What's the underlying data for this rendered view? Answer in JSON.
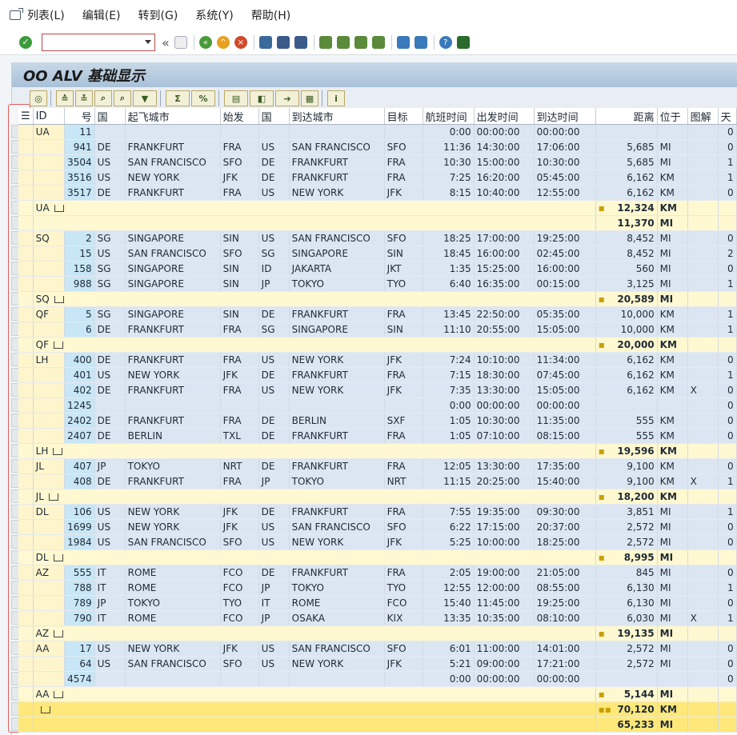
{
  "menu": {
    "items": [
      "列表(L)",
      "编辑(E)",
      "转到(G)",
      "系统(Y)",
      "帮助(H)"
    ]
  },
  "toolbar": {
    "command_placeholder": "",
    "double_arrow": "«"
  },
  "title": "OO ALV 基础显示",
  "columns": [
    "ID",
    "号",
    "国",
    "起飞城市",
    "始发",
    "国",
    "到达城市",
    "目标",
    "航班时间",
    "出发时间",
    "到达时间",
    "距离",
    "位于",
    "图解",
    "天"
  ],
  "colors": {
    "title_bar": "#b4c9dd",
    "subtotal": "#fff8d0",
    "total": "#ffe87a",
    "selection_border": "#e05a5a"
  },
  "rows": [
    {
      "kind": "data",
      "cells": [
        "UA",
        "11",
        "",
        "",
        "",
        "",
        "",
        "",
        "0:00",
        "00:00:00",
        "00:00:00",
        "",
        "",
        "",
        "0"
      ]
    },
    {
      "kind": "data",
      "cells": [
        "",
        "941",
        "DE",
        "FRANKFURT",
        "FRA",
        "US",
        "SAN FRANCISCO",
        "SFO",
        "11:36",
        "14:30:00",
        "17:06:00",
        "5,685",
        "MI",
        "",
        "0"
      ]
    },
    {
      "kind": "data",
      "cells": [
        "",
        "3504",
        "US",
        "SAN FRANCISCO",
        "SFO",
        "DE",
        "FRANKFURT",
        "FRA",
        "10:30",
        "15:00:00",
        "10:30:00",
        "5,685",
        "MI",
        "",
        "1"
      ]
    },
    {
      "kind": "data",
      "cells": [
        "",
        "3516",
        "US",
        "NEW YORK",
        "JFK",
        "DE",
        "FRANKFURT",
        "FRA",
        "7:25",
        "16:20:00",
        "05:45:00",
        "6,162",
        "KM",
        "",
        "1"
      ]
    },
    {
      "kind": "data",
      "cells": [
        "",
        "3517",
        "DE",
        "FRANKFURT",
        "FRA",
        "US",
        "NEW YORK",
        "JFK",
        "8:15",
        "10:40:00",
        "12:55:00",
        "6,162",
        "KM",
        "",
        "0"
      ]
    },
    {
      "kind": "sub",
      "label": "UA",
      "dist": "12,324",
      "unit": "KM"
    },
    {
      "kind": "sub2",
      "label": "",
      "dist": "11,370",
      "unit": "MI"
    },
    {
      "kind": "data",
      "cells": [
        "SQ",
        "2",
        "SG",
        "SINGAPORE",
        "SIN",
        "US",
        "SAN FRANCISCO",
        "SFO",
        "18:25",
        "17:00:00",
        "19:25:00",
        "8,452",
        "MI",
        "",
        "0"
      ]
    },
    {
      "kind": "data",
      "cells": [
        "",
        "15",
        "US",
        "SAN FRANCISCO",
        "SFO",
        "SG",
        "SINGAPORE",
        "SIN",
        "18:45",
        "16:00:00",
        "02:45:00",
        "8,452",
        "MI",
        "",
        "2"
      ]
    },
    {
      "kind": "data",
      "cells": [
        "",
        "158",
        "SG",
        "SINGAPORE",
        "SIN",
        "ID",
        "JAKARTA",
        "JKT",
        "1:35",
        "15:25:00",
        "16:00:00",
        "560",
        "MI",
        "",
        "0"
      ]
    },
    {
      "kind": "data",
      "cells": [
        "",
        "988",
        "SG",
        "SINGAPORE",
        "SIN",
        "JP",
        "TOKYO",
        "TYO",
        "6:40",
        "16:35:00",
        "00:15:00",
        "3,125",
        "MI",
        "",
        "1"
      ]
    },
    {
      "kind": "sub",
      "label": "SQ",
      "dist": "20,589",
      "unit": "MI"
    },
    {
      "kind": "data",
      "cells": [
        "QF",
        "5",
        "SG",
        "SINGAPORE",
        "SIN",
        "DE",
        "FRANKFURT",
        "FRA",
        "13:45",
        "22:50:00",
        "05:35:00",
        "10,000",
        "KM",
        "",
        "1"
      ]
    },
    {
      "kind": "data",
      "cells": [
        "",
        "6",
        "DE",
        "FRANKFURT",
        "FRA",
        "SG",
        "SINGAPORE",
        "SIN",
        "11:10",
        "20:55:00",
        "15:05:00",
        "10,000",
        "KM",
        "",
        "1"
      ]
    },
    {
      "kind": "sub",
      "label": "QF",
      "dist": "20,000",
      "unit": "KM"
    },
    {
      "kind": "data",
      "cells": [
        "LH",
        "400",
        "DE",
        "FRANKFURT",
        "FRA",
        "US",
        "NEW YORK",
        "JFK",
        "7:24",
        "10:10:00",
        "11:34:00",
        "6,162",
        "KM",
        "",
        "0"
      ]
    },
    {
      "kind": "data",
      "cells": [
        "",
        "401",
        "US",
        "NEW YORK",
        "JFK",
        "DE",
        "FRANKFURT",
        "FRA",
        "7:15",
        "18:30:00",
        "07:45:00",
        "6,162",
        "KM",
        "",
        "1"
      ]
    },
    {
      "kind": "data",
      "cells": [
        "",
        "402",
        "DE",
        "FRANKFURT",
        "FRA",
        "US",
        "NEW YORK",
        "JFK",
        "7:35",
        "13:30:00",
        "15:05:00",
        "6,162",
        "KM",
        "X",
        "0"
      ]
    },
    {
      "kind": "data",
      "cells": [
        "",
        "1245",
        "",
        "",
        "",
        "",
        "",
        "",
        "0:00",
        "00:00:00",
        "00:00:00",
        "",
        "",
        "",
        "0"
      ]
    },
    {
      "kind": "data",
      "cells": [
        "",
        "2402",
        "DE",
        "FRANKFURT",
        "FRA",
        "DE",
        "BERLIN",
        "SXF",
        "1:05",
        "10:30:00",
        "11:35:00",
        "555",
        "KM",
        "",
        "0"
      ]
    },
    {
      "kind": "data",
      "cells": [
        "",
        "2407",
        "DE",
        "BERLIN",
        "TXL",
        "DE",
        "FRANKFURT",
        "FRA",
        "1:05",
        "07:10:00",
        "08:15:00",
        "555",
        "KM",
        "",
        "0"
      ]
    },
    {
      "kind": "sub",
      "label": "LH",
      "dist": "19,596",
      "unit": "KM"
    },
    {
      "kind": "data",
      "cells": [
        "JL",
        "407",
        "JP",
        "TOKYO",
        "NRT",
        "DE",
        "FRANKFURT",
        "FRA",
        "12:05",
        "13:30:00",
        "17:35:00",
        "9,100",
        "KM",
        "",
        "0"
      ]
    },
    {
      "kind": "data",
      "cells": [
        "",
        "408",
        "DE",
        "FRANKFURT",
        "FRA",
        "JP",
        "TOKYO",
        "NRT",
        "11:15",
        "20:25:00",
        "15:40:00",
        "9,100",
        "KM",
        "X",
        "1"
      ]
    },
    {
      "kind": "sub",
      "label": "JL",
      "dist": "18,200",
      "unit": "KM"
    },
    {
      "kind": "data",
      "cells": [
        "DL",
        "106",
        "US",
        "NEW YORK",
        "JFK",
        "DE",
        "FRANKFURT",
        "FRA",
        "7:55",
        "19:35:00",
        "09:30:00",
        "3,851",
        "MI",
        "",
        "1"
      ]
    },
    {
      "kind": "data",
      "cells": [
        "",
        "1699",
        "US",
        "NEW YORK",
        "JFK",
        "US",
        "SAN FRANCISCO",
        "SFO",
        "6:22",
        "17:15:00",
        "20:37:00",
        "2,572",
        "MI",
        "",
        "0"
      ]
    },
    {
      "kind": "data",
      "cells": [
        "",
        "1984",
        "US",
        "SAN FRANCISCO",
        "SFO",
        "US",
        "NEW YORK",
        "JFK",
        "5:25",
        "10:00:00",
        "18:25:00",
        "2,572",
        "MI",
        "",
        "0"
      ]
    },
    {
      "kind": "sub",
      "label": "DL",
      "dist": "8,995",
      "unit": "MI"
    },
    {
      "kind": "data",
      "cells": [
        "AZ",
        "555",
        "IT",
        "ROME",
        "FCO",
        "DE",
        "FRANKFURT",
        "FRA",
        "2:05",
        "19:00:00",
        "21:05:00",
        "845",
        "MI",
        "",
        "0"
      ]
    },
    {
      "kind": "data",
      "cells": [
        "",
        "788",
        "IT",
        "ROME",
        "FCO",
        "JP",
        "TOKYO",
        "TYO",
        "12:55",
        "12:00:00",
        "08:55:00",
        "6,130",
        "MI",
        "",
        "1"
      ]
    },
    {
      "kind": "data",
      "cells": [
        "",
        "789",
        "JP",
        "TOKYO",
        "TYO",
        "IT",
        "ROME",
        "FCO",
        "15:40",
        "11:45:00",
        "19:25:00",
        "6,130",
        "MI",
        "",
        "0"
      ]
    },
    {
      "kind": "data",
      "cells": [
        "",
        "790",
        "IT",
        "ROME",
        "FCO",
        "JP",
        "OSAKA",
        "KIX",
        "13:35",
        "10:35:00",
        "08:10:00",
        "6,030",
        "MI",
        "X",
        "1"
      ]
    },
    {
      "kind": "sub",
      "label": "AZ",
      "dist": "19,135",
      "unit": "MI"
    },
    {
      "kind": "data",
      "cells": [
        "AA",
        "17",
        "US",
        "NEW YORK",
        "JFK",
        "US",
        "SAN FRANCISCO",
        "SFO",
        "6:01",
        "11:00:00",
        "14:01:00",
        "2,572",
        "MI",
        "",
        "0"
      ]
    },
    {
      "kind": "data",
      "cells": [
        "",
        "64",
        "US",
        "SAN FRANCISCO",
        "SFO",
        "US",
        "NEW YORK",
        "JFK",
        "5:21",
        "09:00:00",
        "17:21:00",
        "2,572",
        "MI",
        "",
        "0"
      ]
    },
    {
      "kind": "data",
      "cells": [
        "",
        "4574",
        "",
        "",
        "",
        "",
        "",
        "",
        "0:00",
        "00:00:00",
        "00:00:00",
        "",
        "",
        "",
        "0"
      ]
    },
    {
      "kind": "sub",
      "label": "AA",
      "dist": "5,144",
      "unit": "MI"
    },
    {
      "kind": "total",
      "label": "",
      "dist": "70,120",
      "unit": "KM"
    },
    {
      "kind": "total2",
      "label": "",
      "dist": "65,233",
      "unit": "MI"
    }
  ]
}
